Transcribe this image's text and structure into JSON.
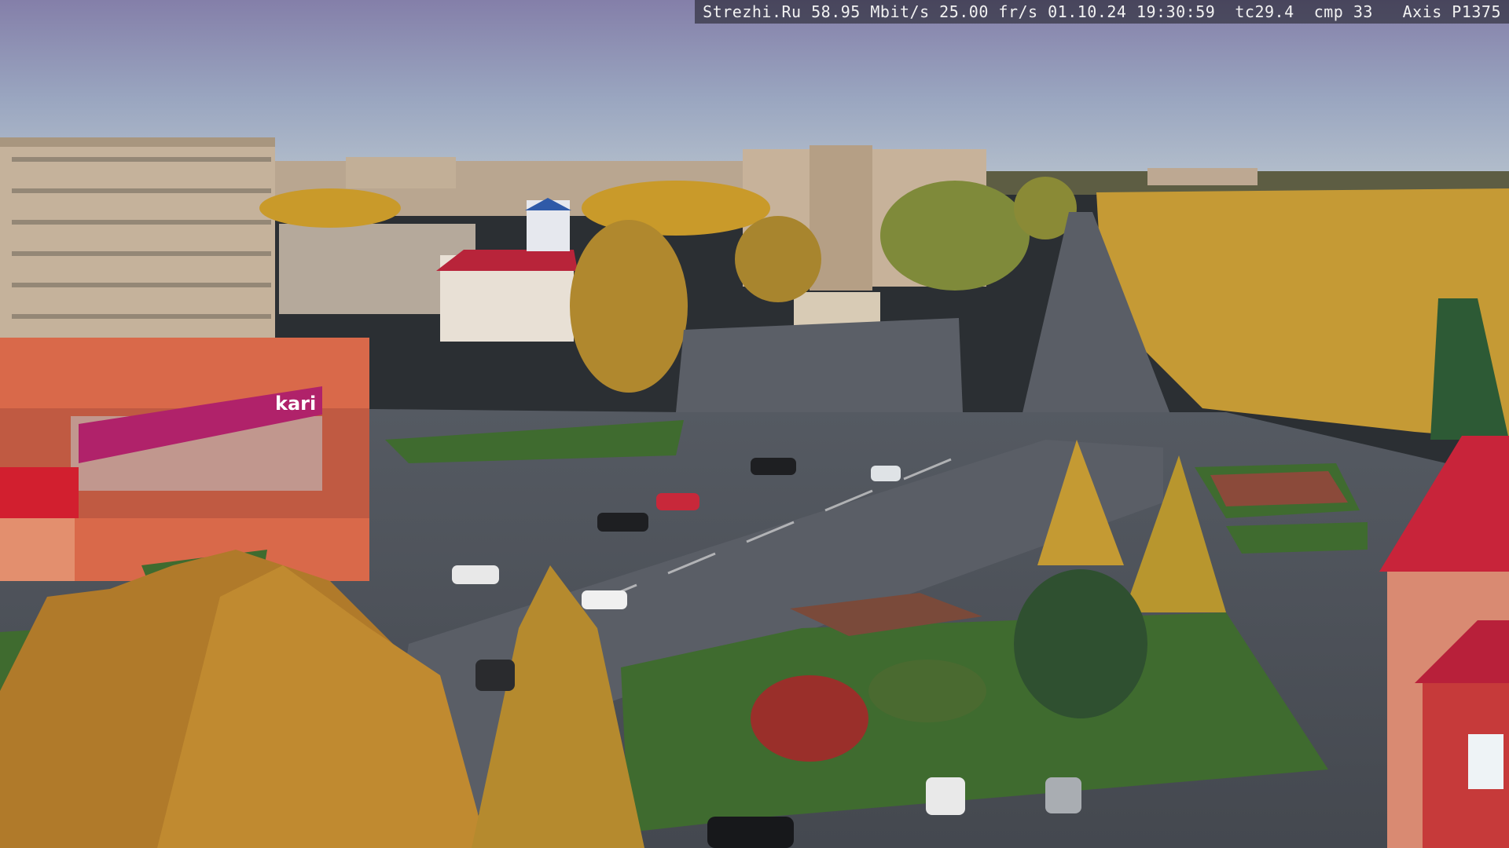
{
  "overlay": {
    "text": "Strezhi.Ru 58.95 Mbit/s 25.00 fr/s 01.10.24 19:30:59  tc29.4  cmp 33   Axis P1375"
  },
  "scene": {
    "store_sign": "kari"
  },
  "colors": {
    "sky_top": "#8a87b0",
    "sky_bottom": "#a9b4c6",
    "asphalt": "#4a4e55",
    "grass": "#3f6b2f",
    "autumn_foliage": "#c99a2a",
    "storefront": "#d9694a",
    "sign_magenta": "#b0226a",
    "tower_red": "#c8243a"
  }
}
